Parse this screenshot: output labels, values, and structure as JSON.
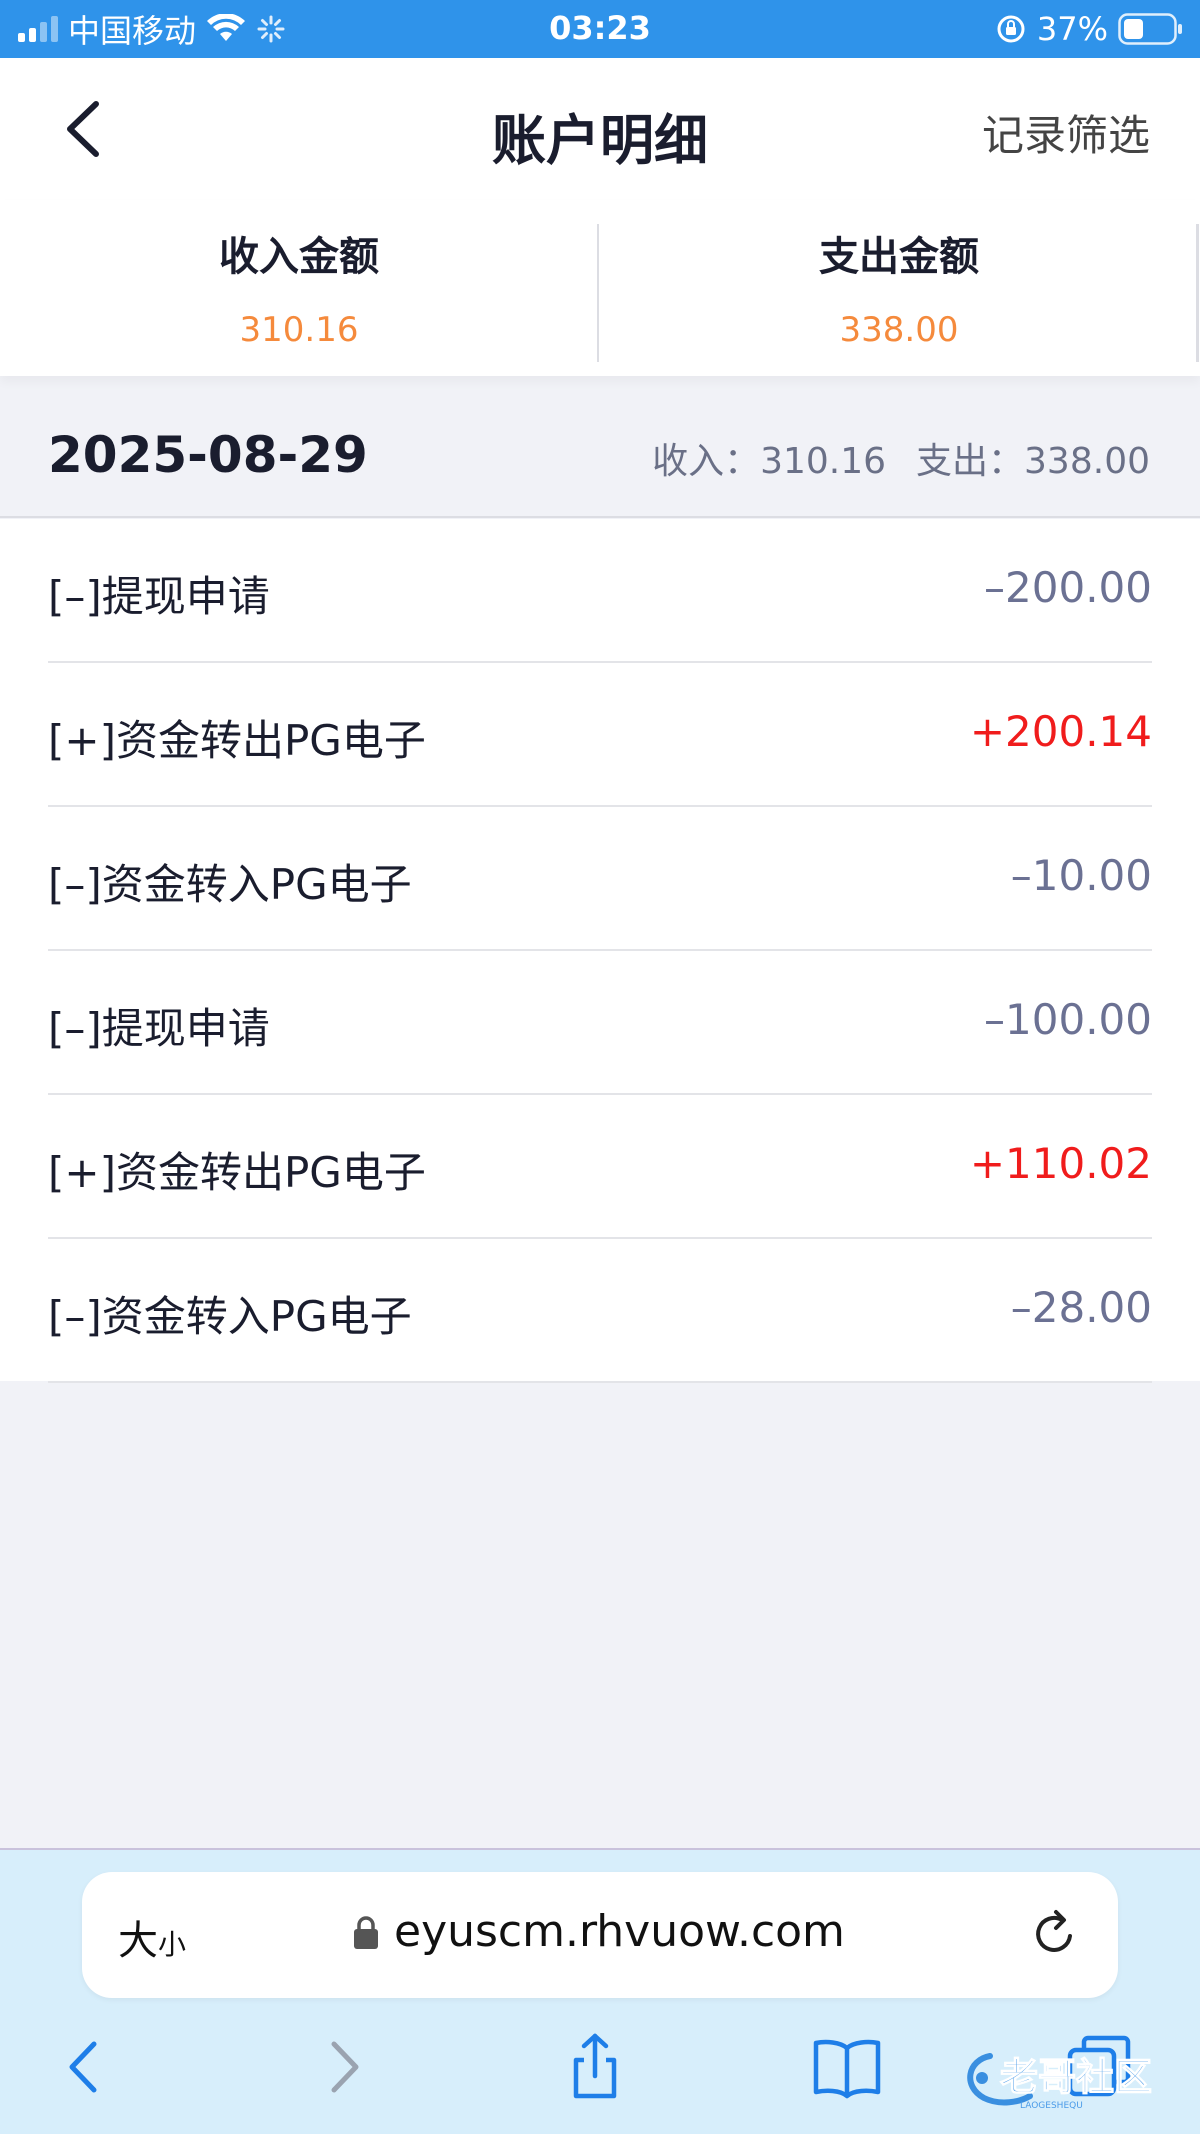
{
  "status_bar": {
    "carrier": "中国移动",
    "time": "03:23",
    "battery": "37%"
  },
  "header": {
    "title": "账户明细",
    "filter_label": "记录筛选"
  },
  "summary": {
    "income_label": "收入金额",
    "income_value": "310.16",
    "expense_label": "支出金额",
    "expense_value": "338.00",
    "value_color": "#f58a3c"
  },
  "day": {
    "date": "2025-08-29",
    "income": "收入：310.16",
    "expense": "支出：338.00"
  },
  "transactions": [
    {
      "label": "[–]提现申请",
      "amount": "–200.00",
      "type": "negative"
    },
    {
      "label": "[+]资金转出PG电子",
      "amount": "+200.14",
      "type": "positive"
    },
    {
      "label": "[–]资金转入PG电子",
      "amount": "–10.00",
      "type": "negative"
    },
    {
      "label": "[–]提现申请",
      "amount": "–100.00",
      "type": "negative"
    },
    {
      "label": "[+]资金转出PG电子",
      "amount": "+110.02",
      "type": "positive"
    },
    {
      "label": "[–]资金转入PG电子",
      "amount": "–28.00",
      "type": "negative"
    }
  ],
  "browser": {
    "text_size_big": "大",
    "text_size_small": "小",
    "url": "eyuscm.rhvuow.com"
  },
  "watermark": {
    "text": "老哥社区",
    "subtext": "LAOGESHEQU"
  },
  "colors": {
    "status_bar": "#2f93ea",
    "positive": "#f01c1c",
    "negative": "#6b7193"
  }
}
